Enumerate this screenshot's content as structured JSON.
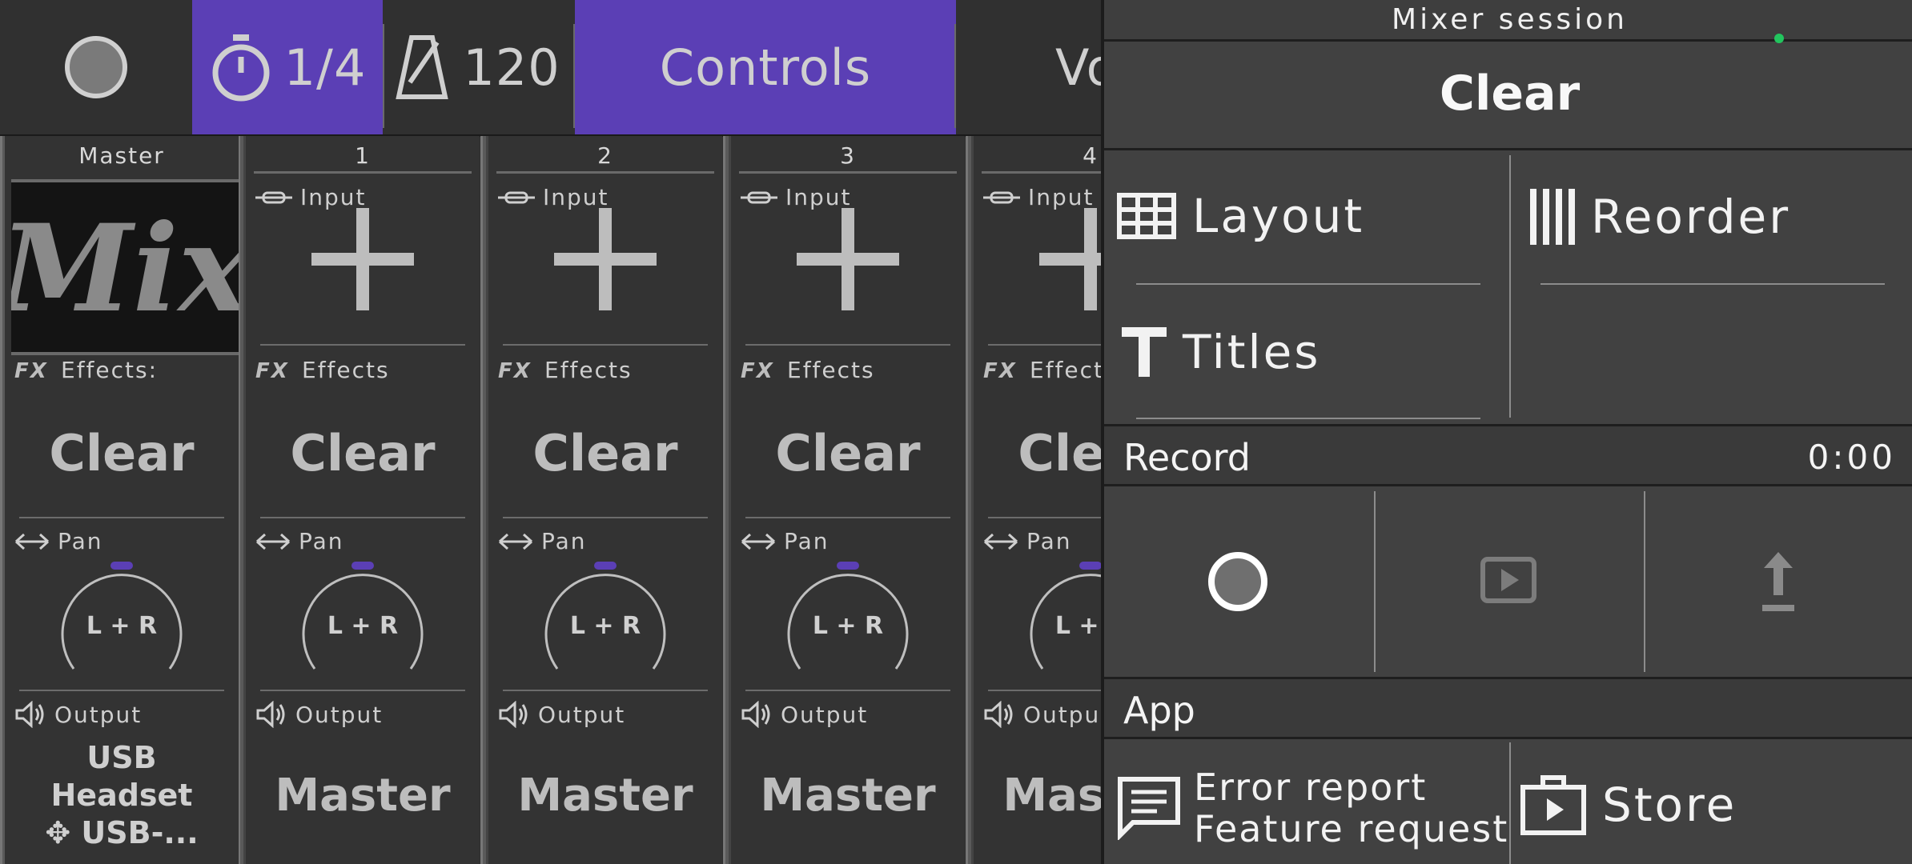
{
  "transport": {
    "quantize": "1/4",
    "tempo": "120",
    "tab_controls": "Controls",
    "tab_next_partial": "Vo"
  },
  "strips": [
    {
      "name": "Master",
      "input_art": "Mix",
      "effects_label": "Effects:",
      "effects_value": "Clear",
      "pan_label": "Pan",
      "pan_value": "L + R",
      "output_label": "Output",
      "output_line1": "USB",
      "output_line2": "Headset",
      "output_line3": "USB-..."
    },
    {
      "name": "1",
      "input_label": "Input",
      "effects_label": "Effects",
      "effects_value": "Clear",
      "pan_label": "Pan",
      "pan_value": "L + R",
      "output_label": "Output",
      "output_value": "Master"
    },
    {
      "name": "2",
      "input_label": "Input",
      "effects_label": "Effects",
      "effects_value": "Clear",
      "pan_label": "Pan",
      "pan_value": "L + R",
      "output_label": "Output",
      "output_value": "Master"
    },
    {
      "name": "3",
      "input_label": "Input",
      "effects_label": "Effects",
      "effects_value": "Clear",
      "pan_label": "Pan",
      "pan_value": "L + R",
      "output_label": "Output",
      "output_value": "Master"
    },
    {
      "name": "4",
      "input_label": "Input",
      "effects_label": "Effects",
      "effects_value": "Clear",
      "pan_label": "Pan",
      "pan_value": "L + R",
      "output_label": "Output",
      "output_value": "Master"
    }
  ],
  "panel": {
    "title": "Mixer session",
    "clear": "Clear",
    "layout": "Layout",
    "reorder": "Reorder",
    "titles": "Titles",
    "record_label": "Record",
    "record_time": "0:00",
    "app_label": "App",
    "error_report": "Error report",
    "feature_request": "Feature request",
    "store": "Store"
  },
  "colors": {
    "accent": "#5b3fb5",
    "pan_indicator": "#5b3fb5",
    "status_dot": "#22c55e"
  },
  "icons": [
    "record-circle-icon",
    "timer-icon",
    "metronome-icon",
    "input-link-icon",
    "add-plus-icon",
    "fx-icon",
    "pan-arrows-icon",
    "speaker-icon",
    "usb-icon",
    "grid-icon",
    "reorder-bars-icon",
    "title-t-icon",
    "play-icon",
    "upload-icon",
    "feedback-icon",
    "store-icon"
  ]
}
